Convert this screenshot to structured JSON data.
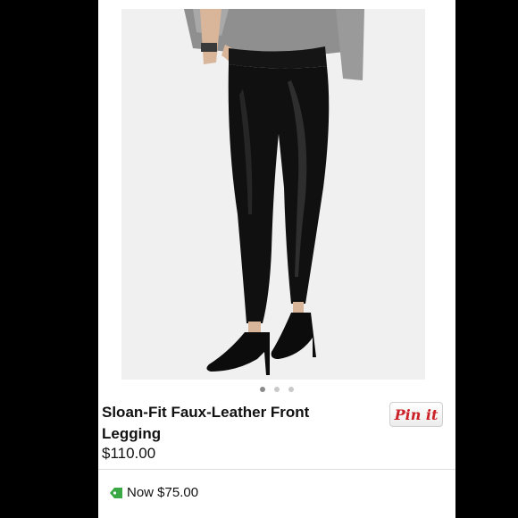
{
  "product": {
    "title": "Sloan-Fit Faux-Leather Front Legging",
    "price": "$110.00",
    "sale_price": "Now $75.00"
  },
  "pin_button": {
    "label": "Pin it"
  },
  "carousel": {
    "total": 3,
    "active_index": 0
  },
  "colors": {
    "pin_red": "#cb2027",
    "tag_green": "#3aa845"
  },
  "icons": {
    "sale": "price-tag-icon"
  }
}
